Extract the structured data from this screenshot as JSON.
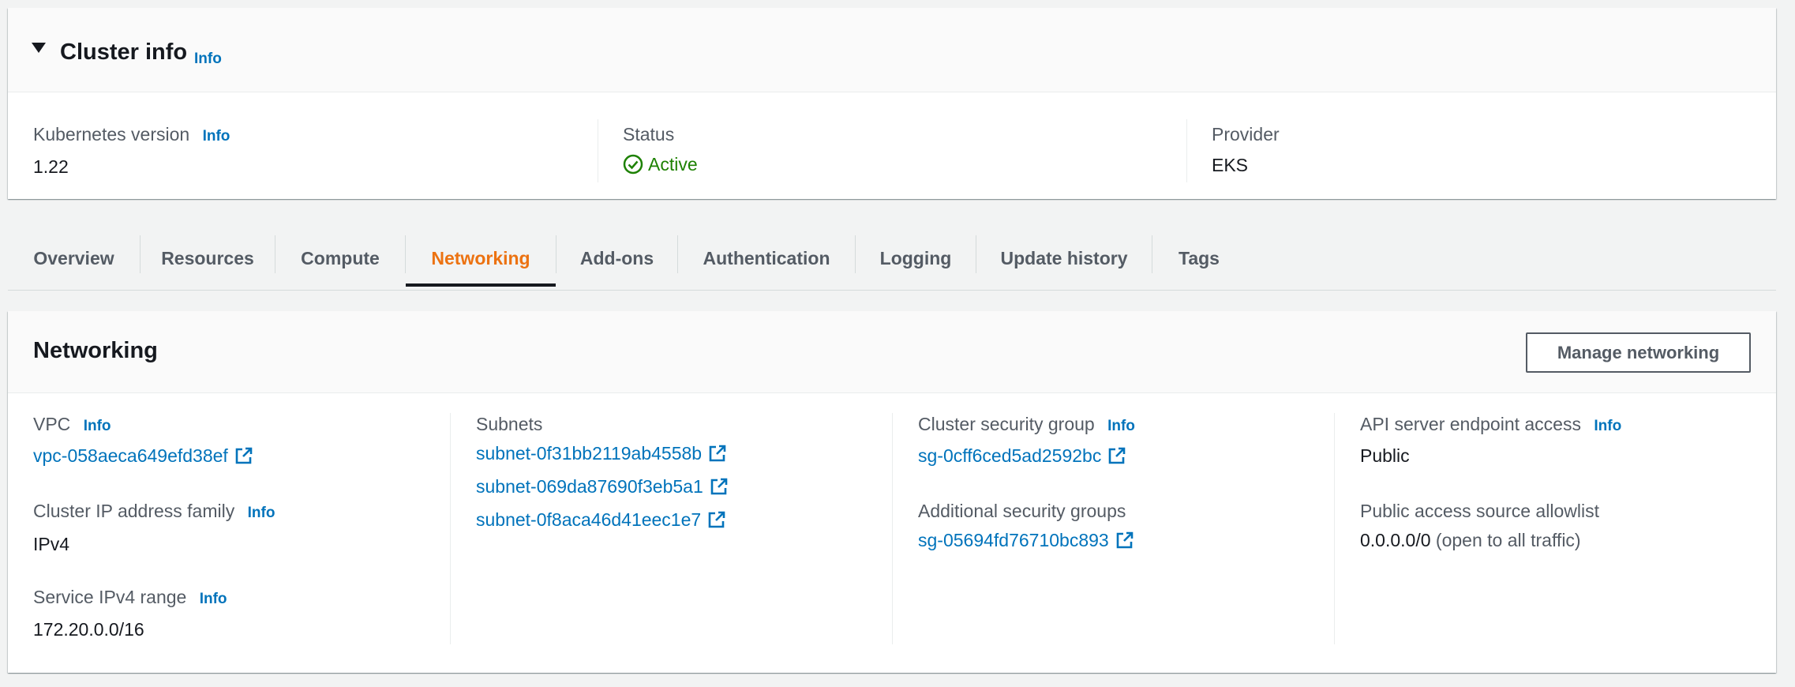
{
  "cluster_info": {
    "title": "Cluster info",
    "info": "Info",
    "kubernetes_version": {
      "label": "Kubernetes version",
      "info": "Info",
      "value": "1.22"
    },
    "status": {
      "label": "Status",
      "value": "Active",
      "icon": "check-circle-icon",
      "color": "#1d8102"
    },
    "provider": {
      "label": "Provider",
      "value": "EKS"
    }
  },
  "tabs": [
    {
      "label": "Overview",
      "active": false
    },
    {
      "label": "Resources",
      "active": false
    },
    {
      "label": "Compute",
      "active": false
    },
    {
      "label": "Networking",
      "active": true
    },
    {
      "label": "Add-ons",
      "active": false
    },
    {
      "label": "Authentication",
      "active": false
    },
    {
      "label": "Logging",
      "active": false
    },
    {
      "label": "Update history",
      "active": false
    },
    {
      "label": "Tags",
      "active": false
    }
  ],
  "networking": {
    "title": "Networking",
    "manage_button": "Manage networking",
    "vpc": {
      "label": "VPC",
      "info": "Info",
      "value": "vpc-058aeca649efd38ef"
    },
    "ip_family": {
      "label": "Cluster IP address family",
      "info": "Info",
      "value": "IPv4"
    },
    "service_range": {
      "label": "Service IPv4 range",
      "info": "Info",
      "value": "172.20.0.0/16"
    },
    "subnets": {
      "label": "Subnets",
      "items": [
        "subnet-0f31bb2119ab4558b",
        "subnet-069da87690f3eb5a1",
        "subnet-0f8aca46d41eec1e7"
      ]
    },
    "cluster_sg": {
      "label": "Cluster security group",
      "info": "Info",
      "value": "sg-0cff6ced5ad2592bc"
    },
    "additional_sg": {
      "label": "Additional security groups",
      "value": "sg-05694fd76710bc893"
    },
    "endpoint_access": {
      "label": "API server endpoint access",
      "info": "Info",
      "value": "Public"
    },
    "allowlist": {
      "label": "Public access source allowlist",
      "value": "0.0.0.0/0",
      "note": "(open to all traffic)"
    }
  },
  "colors": {
    "link": "#0073bb",
    "active_tab": "#ec7211",
    "success": "#1d8102"
  }
}
